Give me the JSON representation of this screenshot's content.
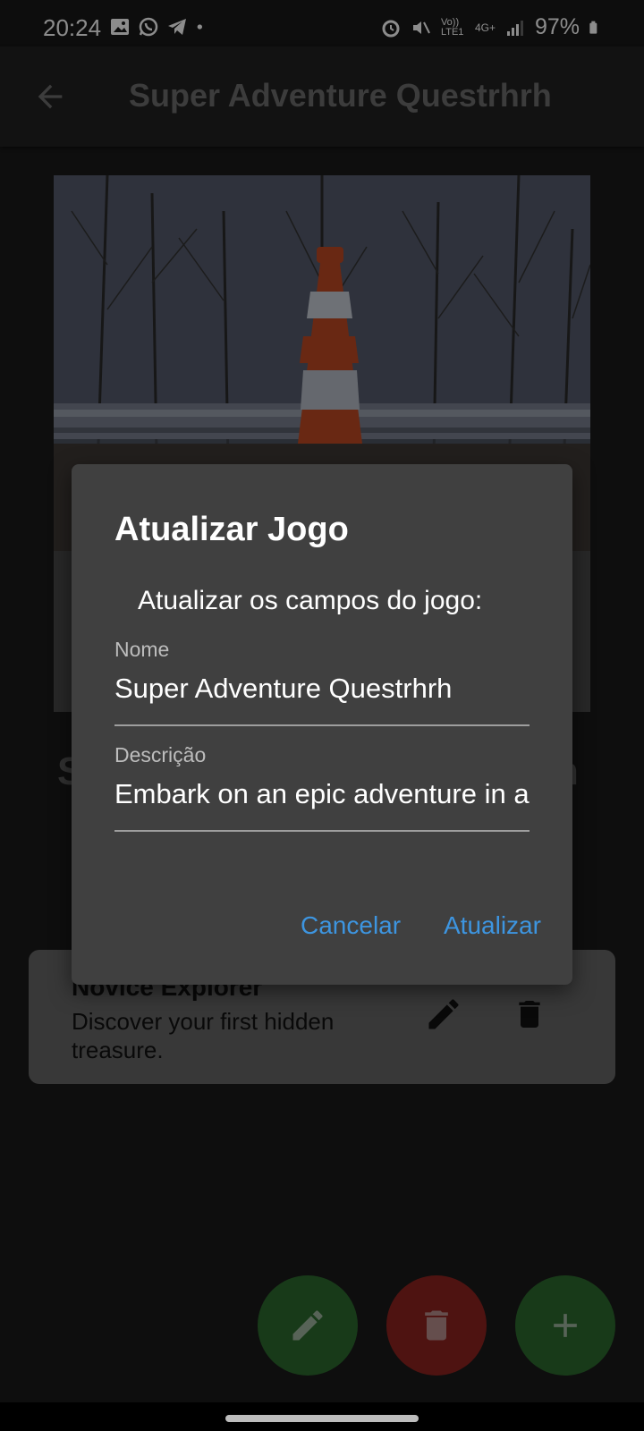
{
  "status_bar": {
    "time": "20:24",
    "battery": "97%",
    "network_label": "4G+",
    "volte_label": "Vo)) LTE1"
  },
  "app_bar": {
    "title": "Super Adventure Questrhrh"
  },
  "background": {
    "title_fragment_left": "S",
    "title_fragment_right": "h"
  },
  "achievement": {
    "title": "Novice Explorer",
    "description": "Discover your first hidden treasure."
  },
  "dialog": {
    "title": "Atualizar Jogo",
    "subtitle": "Atualizar os campos do jogo:",
    "name_label": "Nome",
    "name_value": "Super Adventure Questrhrh",
    "description_label": "Descrição",
    "description_value": "Embark on an epic adventure in a",
    "cancel_label": "Cancelar",
    "update_label": "Atualizar"
  },
  "colors": {
    "accent": "#3d95e0",
    "fab_green": "#2d6a2f",
    "fab_red": "#8f2420"
  }
}
